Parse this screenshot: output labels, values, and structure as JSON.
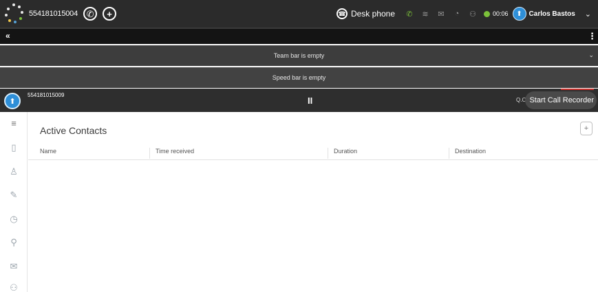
{
  "topbar": {
    "number": "554181015004",
    "desk_phone_label": "Desk phone",
    "timer": "00:06",
    "user_name": "Carlos Bastos",
    "colors": {
      "status": "#7cc13a",
      "background": "#2b2b2b"
    },
    "icons": [
      "phone-dial-icon",
      "add-icon",
      "headset-icon",
      "queue-icon",
      "email-icon",
      "help-icon",
      "group-icon",
      "status-icon",
      "avatar-icon",
      "chevron-down-icon"
    ]
  },
  "bars": {
    "team": "Team bar is empty",
    "speed": "Speed bar is empty"
  },
  "call": {
    "number": "554181015009",
    "pause_glyph": "II",
    "qo_label": "Q.O",
    "recorder_label": "Start Call Recorder",
    "colors": {
      "recorder_accent": "#d0312d"
    }
  },
  "sidebar": {
    "icons": [
      "menu-icon",
      "contacts-book-icon",
      "agents-icon",
      "phonebook-icon",
      "history-icon",
      "search-icon",
      "email-icon",
      "teams-icon"
    ]
  },
  "main": {
    "title": "Active Contacts",
    "add_label": "+",
    "columns": [
      "Name",
      "Time received",
      "Duration",
      "Destination"
    ],
    "rows": []
  }
}
